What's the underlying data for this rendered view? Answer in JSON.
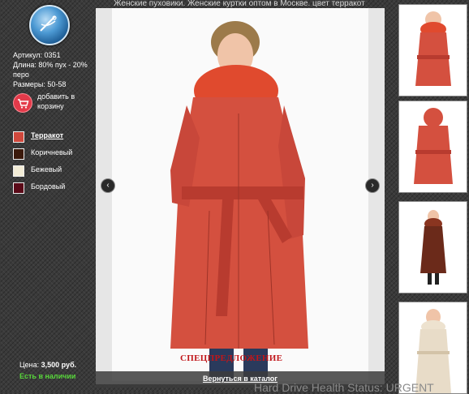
{
  "title": "Женские пуховики. Женские куртки оптом в Москве. цвет терракот",
  "product": {
    "article": "Артикул: 0351",
    "length": "Длина: 80% пух - 20% перо",
    "sizes": "Размеры: 50-58",
    "cart_label": "добавить в корзину"
  },
  "colors": [
    {
      "name": "Терракот",
      "hex": "#d0483c",
      "active": true
    },
    {
      "name": "Коричневый",
      "hex": "#3b1a0c",
      "active": false
    },
    {
      "name": "Бежевый",
      "hex": "#f2ecd6",
      "active": false
    },
    {
      "name": "Бордовый",
      "hex": "#5a0a18",
      "active": false
    }
  ],
  "price": {
    "label": "Цена:",
    "value": "3,500 руб."
  },
  "stock": "Есть в наличии",
  "viewer": {
    "watermark": "СПЕЦПРЕДЛОЖЕНИЕ",
    "back_link": "Вернуться в каталог",
    "prev_icon": "chevron-left-icon",
    "next_icon": "chevron-right-icon"
  },
  "underlay_text": "Hard Drive Health Status: URGENT",
  "accent": {
    "coat": "#d4503f",
    "brown": "#6b2a1a",
    "beige": "#e8dcc8"
  }
}
